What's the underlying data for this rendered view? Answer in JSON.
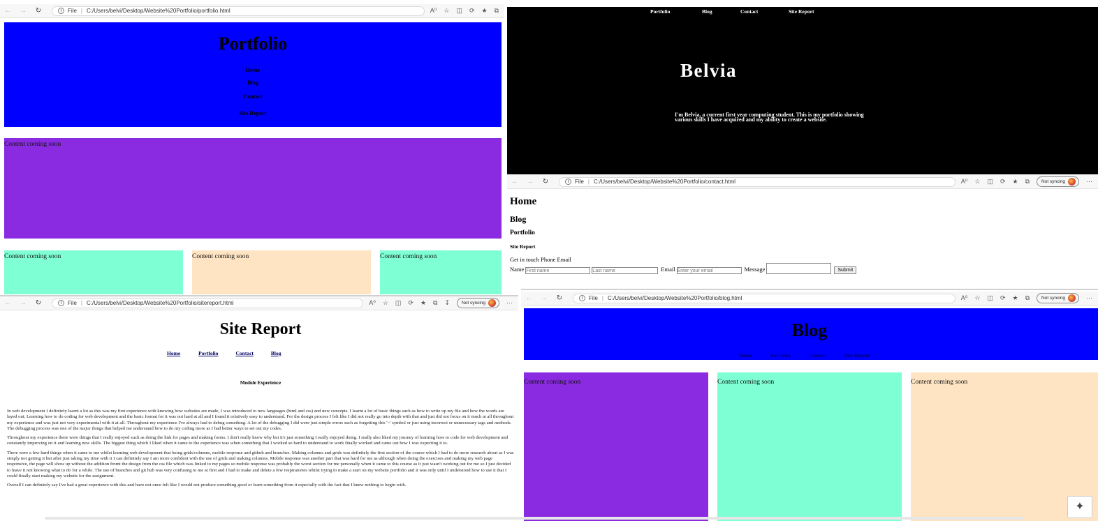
{
  "portfolio_window": {
    "url": "C:/Users/belvi/Desktop/Website%20Portfolio/portfolio.html",
    "file_label": "File",
    "heading": "Portfolio",
    "nav": [
      "Home",
      "Blog",
      "Contact",
      "Site Report"
    ],
    "content": [
      "Content coming soon",
      "Content coming soon",
      "Content coming soon",
      "Content coming soon"
    ]
  },
  "home_window": {
    "nav": [
      "Portfolio",
      "Blog",
      "Contact",
      "Site Report"
    ],
    "title": "Belvia",
    "intro_line1": "I'm Belvia, a current first year computing student. This is my portfolio showing",
    "intro_line2": "various skills I have acquired and my ability to create a website."
  },
  "contact_window": {
    "url": "C:/Users/belvi/Desktop/Website%20Portfolio/contact.html",
    "file_label": "File",
    "sync": "Not syncing",
    "links": [
      "Home",
      "Blog",
      "Portfolio",
      "Site Report"
    ],
    "get_in_touch": "Get in touch Phone Email",
    "name_label": "Name",
    "first_placeholder": "First name",
    "last_placeholder": "Last name",
    "email_label": "Email",
    "email_placeholder": "Enter your email",
    "message_label": "Message",
    "submit": "Submit"
  },
  "sitereport_window": {
    "url": "C:/Users/belvi/Desktop/Website%20Portfolio/sitereport.html",
    "file_label": "File",
    "sync": "Not syncing",
    "heading": "Site Report",
    "nav": [
      "Home",
      "Portfolio",
      "Contact",
      "Blog"
    ],
    "subheading": "Module Experience",
    "paragraphs": [
      "In web development I definitely learnt a lot as this was my first experience with knowing how websites are made, I was introduced to new languages (html and css) and new concepts. I learnt a lot of basic things such as how to write up my file and how the words are layed out. Learning how to do coding for web development and the basic format for it was not hard at all and I found it relatively easy to understand. For the design process I felt like I did not really go into depth with that and just did not focus on it much at all throughout my experience and was just not very experimental with it at all. Throughout my experience I've always had to debug something. A lot of the debugging I did were just simple errors such as forgetting this '>' symbol or just using incorrect or unnecessary tags and methods. The debugging process was one of the major things that helped me understand how to do my coding more as I had better ways to set out my codes.",
      "Throughout my experience there were things that I really enjoyed such as doing the link for pages and making forms. I don't really know why but it's just something I really enjoyed doing. I really also liked my journey of learning how to code for web development and constantly improving on it and learning new skills. The biggest thing which I liked when it came to the experience was when something that I worked so hard to understand to work finally worked and came out how I was expecting it to.",
      "There were a few hard things when it came to me whilst learning web development that being grids/columns, mobile response and github and branches. Making columns and grids was definitely the first section of the course which I had to do more research about as I was simply not getting it but after just taking my time with it I can definitely say I am more confident with the use of grids and making columns. Mobile response was another part that was hard for me as although when doing the exercises and making my web page responsive, the page will show up without the addition fromt the design from the css file which was linked to my pages so mobile response was probably the worst section for me personally when it came to this course as it just wasn't working out for me so I just decided to leave it not knowing what to do for a while. The use of branches and git hub was very confusing to me at first and I had to make and delete a few respiratories whilst trying to make a start on my website portfolio and it was only until I understood how to use it that I could finally start making my website for the assignment.",
      "Overall I can definitely say I've had a great experience with this and have not once felt like I would not produce something good or learn something from it especially with the fact that I knew nothing to begin with."
    ]
  },
  "blog_window": {
    "url": "C:/Users/belvi/Desktop/Website%20Portfolio/blog.html",
    "file_label": "File",
    "sync": "Not syncing",
    "heading": "Blog",
    "nav": [
      "Home",
      "Portfolio",
      "Contact",
      "Site Report"
    ],
    "content": [
      "Content coming soon",
      "Content coming soon",
      "Content coming soon"
    ]
  },
  "colors": {
    "blue": "#0000ff",
    "purple": "#8a2be2",
    "aquamarine": "#7fffd4",
    "bisque": "#ffe4c4",
    "black": "#000000"
  }
}
